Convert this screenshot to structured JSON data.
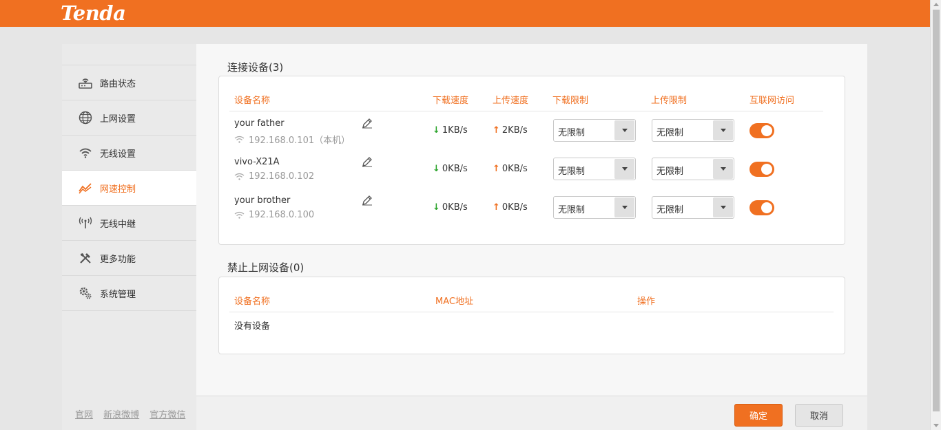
{
  "brand": {
    "logo_text": "Tenda"
  },
  "colors": {
    "accent": "#f07021",
    "download": "#2ea52e"
  },
  "sidebar": {
    "items": [
      {
        "label": "路由状态",
        "icon": "router-icon"
      },
      {
        "label": "上网设置",
        "icon": "globe-icon"
      },
      {
        "label": "无线设置",
        "icon": "wifi-icon"
      },
      {
        "label": "网速控制",
        "icon": "trend-icon"
      },
      {
        "label": "无线中继",
        "icon": "antenna-icon"
      },
      {
        "label": "更多功能",
        "icon": "tools-icon"
      },
      {
        "label": "系统管理",
        "icon": "gear-icon"
      }
    ],
    "links": [
      "官网",
      "新浪微博",
      "官方微信"
    ]
  },
  "connected": {
    "title": "连接设备(3)",
    "headers": [
      "设备名称",
      "下载速度",
      "上传速度",
      "下载限制",
      "上传限制",
      "互联网访问"
    ],
    "devices": [
      {
        "name": "your father",
        "ip": "192.168.0.101（本机）",
        "down": "1KB/s",
        "up": "2KB/s",
        "down_limit": "无限制",
        "up_limit": "无限制",
        "internet_access": true
      },
      {
        "name": "vivo-X21A",
        "ip": "192.168.0.102",
        "down": "0KB/s",
        "up": "0KB/s",
        "down_limit": "无限制",
        "up_limit": "无限制",
        "internet_access": true
      },
      {
        "name": "your brother",
        "ip": "192.168.0.100",
        "down": "0KB/s",
        "up": "0KB/s",
        "down_limit": "无限制",
        "up_limit": "无限制",
        "internet_access": true
      }
    ],
    "arrows": {
      "down": "↓",
      "up": "↑"
    }
  },
  "blocked": {
    "title": "禁止上网设备(0)",
    "headers": [
      "设备名称",
      "MAC地址",
      "操作"
    ],
    "empty_text": "没有设备"
  },
  "footer": {
    "ok_label": "确定",
    "cancel_label": "取消"
  }
}
